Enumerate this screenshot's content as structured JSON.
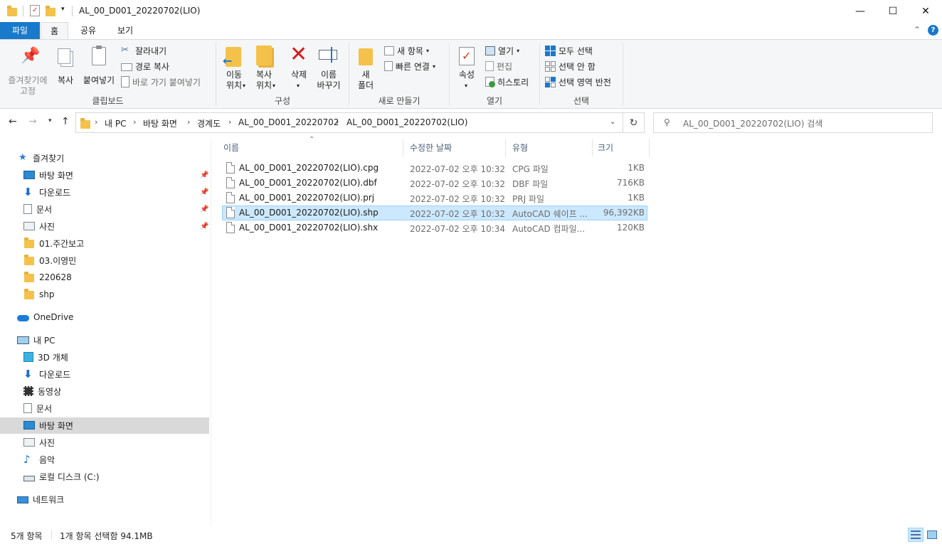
{
  "window": {
    "title": "AL_00_D001_20220702(LIO)",
    "minimize": "—",
    "maximize": "☐",
    "close": "✕"
  },
  "tabs": [
    {
      "label": "파일"
    },
    {
      "label": "홈"
    },
    {
      "label": "공유"
    },
    {
      "label": "보기"
    }
  ],
  "ribbon": {
    "clipboard": {
      "pin_label1": "즐겨찾기에",
      "pin_label2": "고정",
      "copy": "복사",
      "paste": "붙여넣기",
      "cut": "잘라내기",
      "copy_path": "경로 복사",
      "paste_shortcut": "바로 가기 붙여넣기",
      "group": "클립보드"
    },
    "organize": {
      "move_label1": "이동",
      "move_label2": "위치",
      "copy_label1": "복사",
      "copy_label2": "위치",
      "delete": "삭제",
      "rename_label1": "이름",
      "rename_label2": "바꾸기",
      "group": "구성"
    },
    "new": {
      "new_folder1": "새",
      "new_folder2": "폴더",
      "new_item": "새 항목",
      "easy_access": "빠른 연결",
      "group": "새로 만들기"
    },
    "open": {
      "properties": "속성",
      "open": "열기",
      "edit": "편집",
      "history": "히스토리",
      "group": "열기"
    },
    "select": {
      "select_all": "모두 선택",
      "select_none": "선택 안 함",
      "invert": "선택 영역 반전",
      "group": "선택"
    }
  },
  "address": {
    "crumbs": [
      "내 PC",
      "바탕 화면",
      "경계도",
      "AL_00_D001_20220702",
      "AL_00_D001_20220702(LIO)"
    ],
    "search_placeholder": "AL_00_D001_20220702(LIO) 검색"
  },
  "nav": {
    "quick_access": "즐겨찾기",
    "quick_items": [
      "바탕 화면",
      "다운로드",
      "문서",
      "사진",
      "01.주간보고",
      "03.이영민",
      "220628",
      "shp"
    ],
    "onedrive": "OneDrive",
    "this_pc": "내 PC",
    "pc_items": [
      "3D 개체",
      "다운로드",
      "동영상",
      "문서",
      "바탕 화면",
      "사진",
      "음악",
      "로컬 디스크 (C:)"
    ],
    "network": "네트워크"
  },
  "columns": {
    "name": "이름",
    "date": "수정한 날짜",
    "type": "유형",
    "size": "크기"
  },
  "files": [
    {
      "name": "AL_00_D001_20220702(LIO).cpg",
      "date": "2022-07-02 오후 10:32",
      "type": "CPG 파일",
      "size": "1KB"
    },
    {
      "name": "AL_00_D001_20220702(LIO).dbf",
      "date": "2022-07-02 오후 10:32",
      "type": "DBF 파일",
      "size": "716KB"
    },
    {
      "name": "AL_00_D001_20220702(LIO).prj",
      "date": "2022-07-02 오후 10:32",
      "type": "PRJ 파일",
      "size": "1KB"
    },
    {
      "name": "AL_00_D001_20220702(LIO).shp",
      "date": "2022-07-02 오후 10:32",
      "type": "AutoCAD 쉐이프 ...",
      "size": "96,392KB"
    },
    {
      "name": "AL_00_D001_20220702(LIO).shx",
      "date": "2022-07-02 오후 10:34",
      "type": "AutoCAD 컴파일...",
      "size": "120KB"
    }
  ],
  "status": {
    "count": "5개 항목",
    "selection": "1개 항목 선택함 94.1MB"
  },
  "colors": {
    "accent": "#1979ca",
    "selection": "#cce8ff"
  }
}
